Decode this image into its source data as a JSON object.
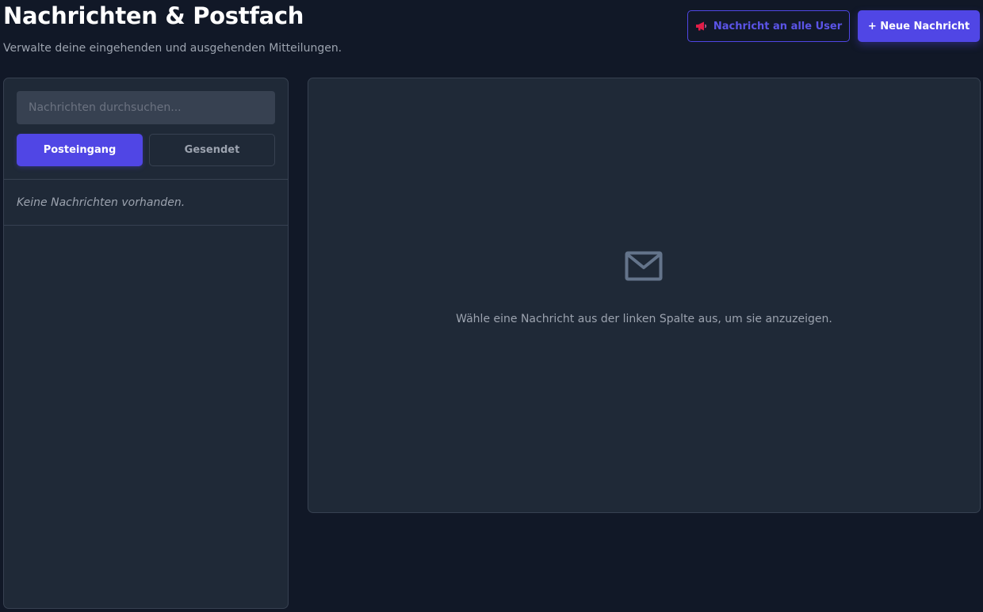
{
  "header": {
    "title": "Nachrichten & Postfach",
    "subtitle": "Verwalte deine eingehenden und ausgehenden Mitteilungen.",
    "broadcast_label": "Nachricht an alle User",
    "new_label": "+ Neue Nachricht"
  },
  "sidebar": {
    "search_placeholder": "Nachrichten durchsuchen...",
    "search_value": "",
    "tabs": [
      {
        "label": "Posteingang",
        "active": true
      },
      {
        "label": "Gesendet",
        "active": false
      }
    ],
    "empty_text": "Keine Nachrichten vorhanden."
  },
  "detail": {
    "icon": "envelope-icon",
    "placeholder": "Wähle eine Nachricht aus der linken Spalte aus, um sie anzuzeigen."
  },
  "colors": {
    "background": "#111827",
    "panel": "#1f2937",
    "accent": "#5046e5",
    "megaphone": "#e11d48"
  }
}
